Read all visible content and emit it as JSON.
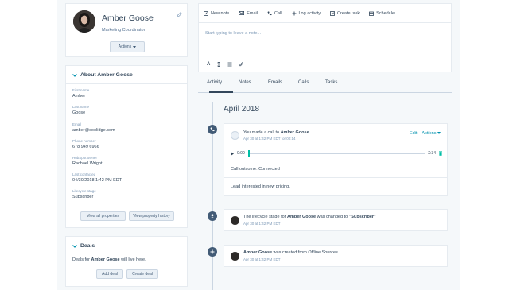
{
  "profile": {
    "name": "Amber Goose",
    "title": "Marketing Coordinator",
    "actions_label": "Actions"
  },
  "about": {
    "heading": "About Amber Goose",
    "properties": [
      {
        "label": "First name",
        "value": "Amber"
      },
      {
        "label": "Last name",
        "value": "Goose"
      },
      {
        "label": "Email",
        "value": "amber@coolidge.com"
      },
      {
        "label": "Phone number",
        "value": "678 949 6966"
      },
      {
        "label": "HubSpot owner",
        "value": "Rachael Wright"
      },
      {
        "label": "Last contacted",
        "value": "04/30/2018 1:42 PM EDT"
      },
      {
        "label": "Lifecycle stage",
        "value": "Subscriber"
      }
    ],
    "view_all_label": "View all properties",
    "view_history_label": "View property history"
  },
  "deals": {
    "heading": "Deals",
    "text_prefix": "Deals for ",
    "text_name": "Amber Goose",
    "text_suffix": " will live here.",
    "add_label": "Add deal",
    "create_label": "Create deal"
  },
  "composer": {
    "tabs": [
      {
        "label": "New note",
        "icon": "note-icon"
      },
      {
        "label": "Email",
        "icon": "email-icon"
      },
      {
        "label": "Call",
        "icon": "phone-icon"
      },
      {
        "label": "Log activity",
        "icon": "plus-icon"
      },
      {
        "label": "Create task",
        "icon": "task-icon"
      },
      {
        "label": "Schedule",
        "icon": "calendar-icon"
      }
    ],
    "placeholder": "Start typing to leave a note...",
    "format_bold": "A"
  },
  "activity_tabs": [
    "Activity",
    "Notes",
    "Emails",
    "Calls",
    "Tasks"
  ],
  "timeline": {
    "month": "April 2018",
    "call": {
      "prefix": "You made a call to ",
      "name": "Amber Goose",
      "time": "Apr 30 at 1:42 PM EDT for 00:14",
      "edit_label": "Edit",
      "actions_label": "Actions",
      "current_time": "0:00",
      "duration": "2:34",
      "outcome": "Call outcome: Connected",
      "note": "Lead interested in new pricing."
    },
    "lifecycle": {
      "prefix": "The lifecycle stage for ",
      "name": "Amber Goose",
      "middle": " was changed to ",
      "stage": "\"Subscriber\"",
      "time": "Apr 30 at 1:42 PM EDT"
    },
    "created": {
      "name": "Amber Goose",
      "suffix": " was created from Offline Sources",
      "time": "Apr 30 at 1:42 PM EDT"
    }
  },
  "colors": {
    "accent": "#0091ae",
    "audio": "#00bda5",
    "text": "#33475b"
  }
}
